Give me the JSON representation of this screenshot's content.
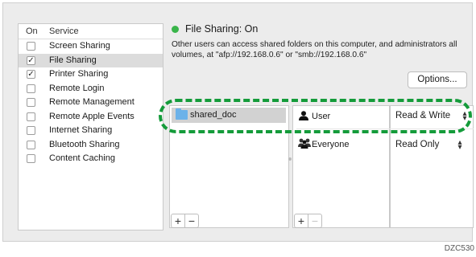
{
  "status": {
    "label": "File Sharing: On",
    "color": "#39b54a"
  },
  "description": "Other users can access shared folders on this computer, and administrators all volumes, at \"afp://192.168.0.6\" or \"smb://192.168.0.6\"",
  "options_button": "Options...",
  "service_list": {
    "header_on": "On",
    "header_service": "Service",
    "items": [
      {
        "name": "Screen Sharing",
        "checked": false
      },
      {
        "name": "File Sharing",
        "checked": true,
        "selected": true
      },
      {
        "name": "Printer Sharing",
        "checked": true
      },
      {
        "name": "Remote Login",
        "checked": false
      },
      {
        "name": "Remote Management",
        "checked": false
      },
      {
        "name": "Remote Apple Events",
        "checked": false
      },
      {
        "name": "Internet Sharing",
        "checked": false
      },
      {
        "name": "Bluetooth Sharing",
        "checked": false
      },
      {
        "name": "Content Caching",
        "checked": false
      }
    ]
  },
  "shared_folders": [
    {
      "name": "shared_doc",
      "icon": "folder-icon"
    }
  ],
  "users": [
    {
      "name": "User",
      "permission": "Read & Write",
      "icon": "user-icon"
    },
    {
      "name": "Everyone",
      "permission": "Read Only",
      "icon": "group-icon"
    }
  ],
  "buttons": {
    "add": "+",
    "remove": "−"
  },
  "highlight_color": "#149b3a",
  "credit": "DZC530"
}
